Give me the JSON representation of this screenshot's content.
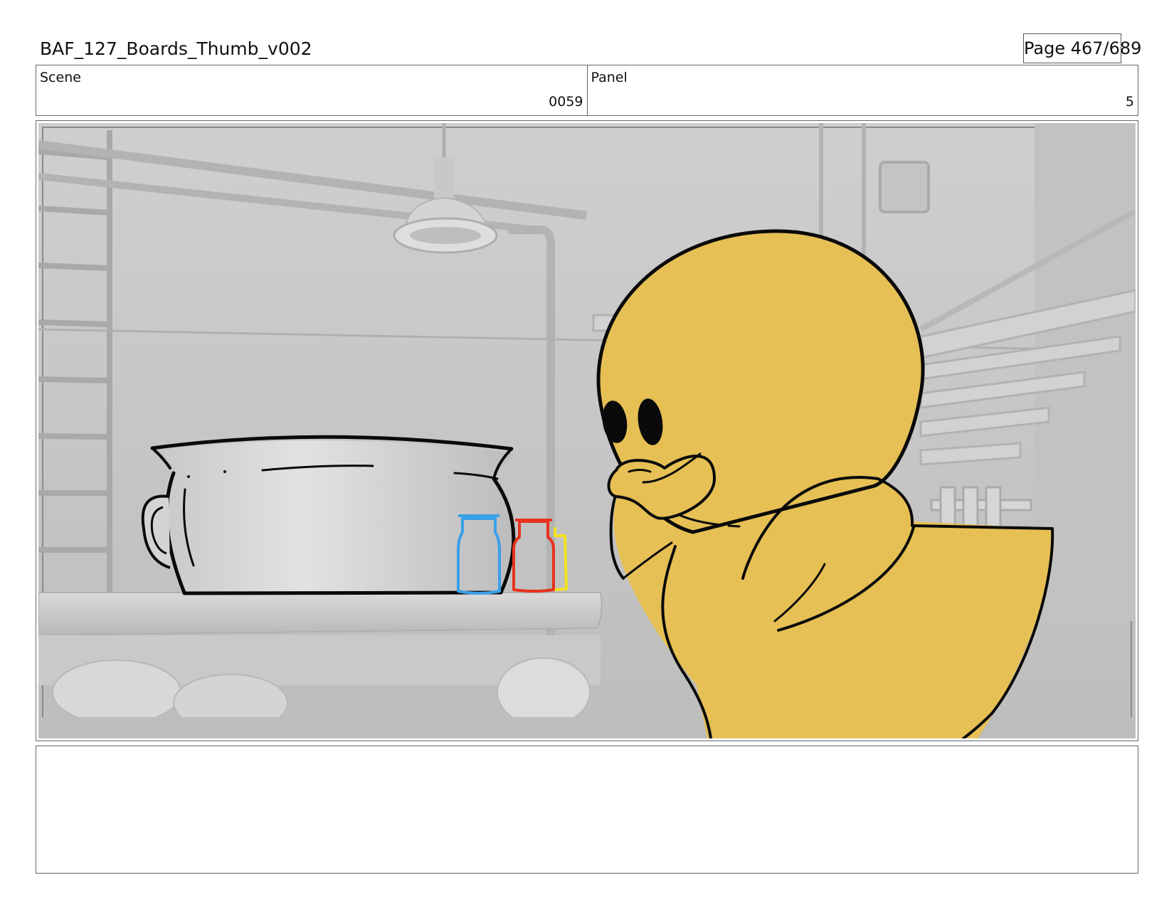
{
  "header": {
    "title": "BAF_127_Boards_Thumb_v002",
    "page": "Page 467/689"
  },
  "info": {
    "scene_label": "Scene",
    "scene_value": "0059",
    "panel_label": "Panel",
    "panel_value": "5"
  },
  "colors": {
    "duck_fill": "#e6c055",
    "line": "#0a0a0a",
    "bottle_blue": "#3aa0e8",
    "bottle_red": "#e8321e",
    "bottle_yellow": "#f2e21e",
    "background_gray": "#c6c6c6"
  }
}
